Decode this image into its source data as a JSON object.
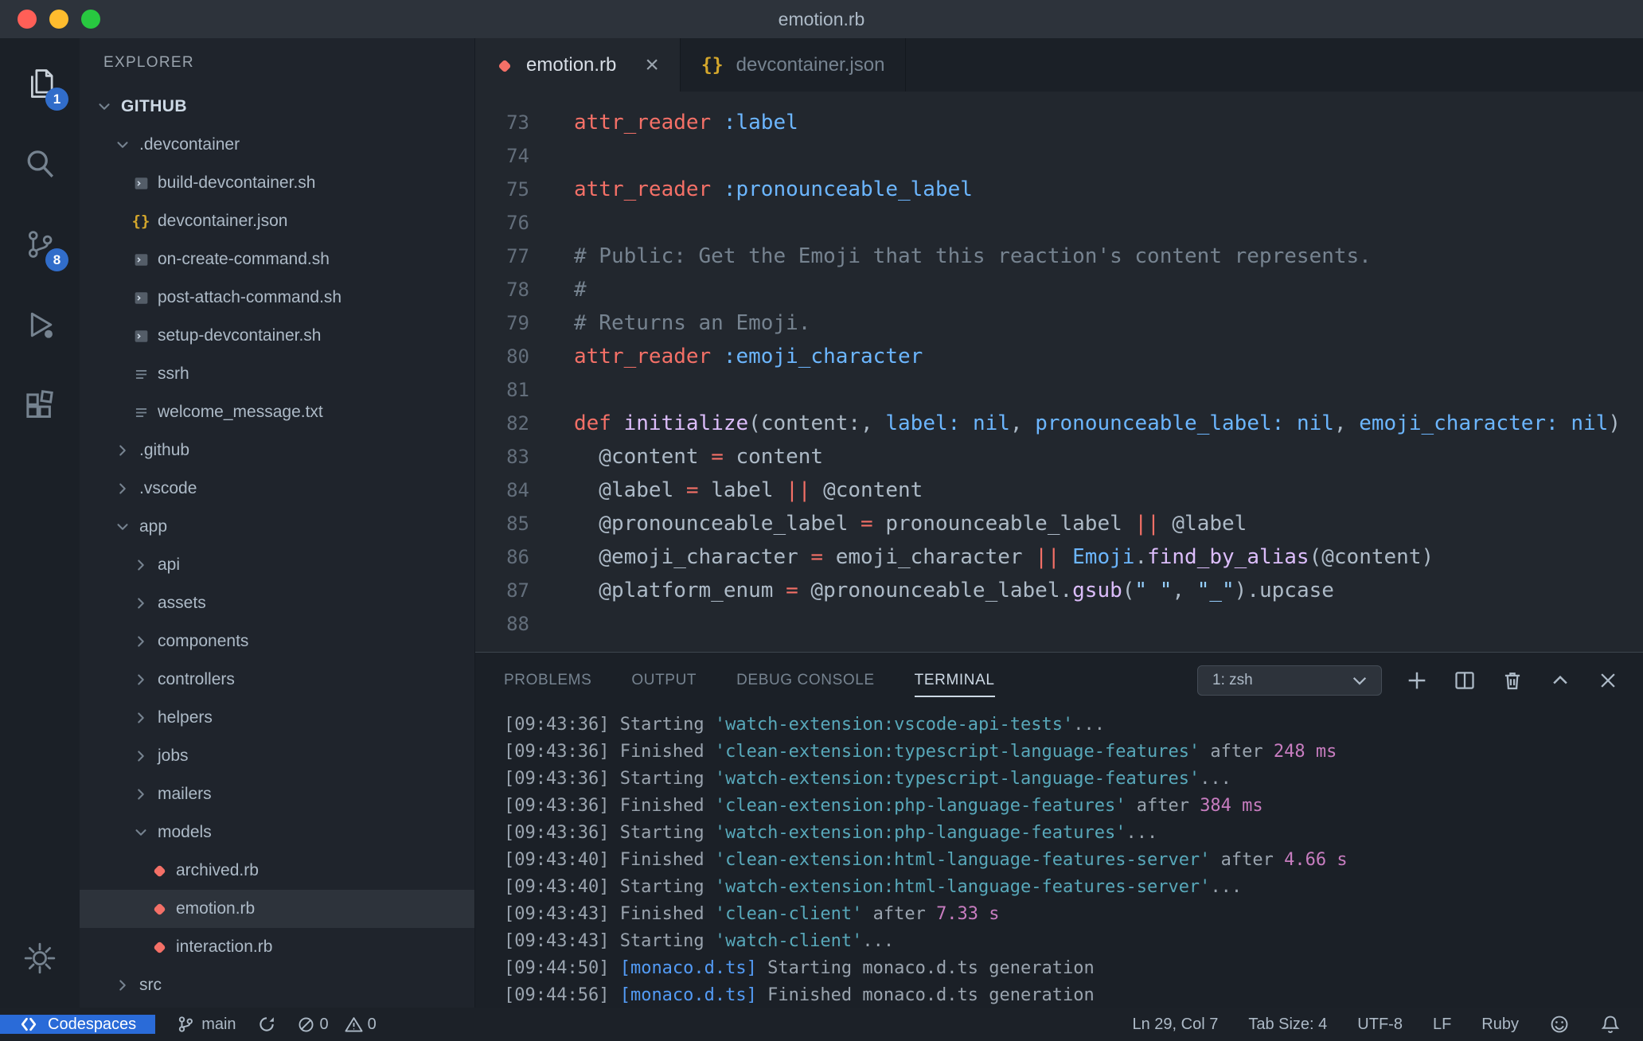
{
  "window": {
    "title": "emotion.rb"
  },
  "colors": {
    "accent_badge_blue": "#316dca",
    "remote_blue": "#2a6bd8",
    "ruby_coral": "#f47067",
    "json_yellow": "#d4a72c",
    "traffic_red": "#ff5f57",
    "traffic_yellow": "#febc2e",
    "traffic_green": "#28c840"
  },
  "activity_bar": {
    "items": [
      {
        "id": "explorer",
        "icon": "files-icon",
        "badge": "1",
        "active": true
      },
      {
        "id": "search",
        "icon": "search-icon"
      },
      {
        "id": "source-control",
        "icon": "git-branch-icon",
        "badge": "8"
      },
      {
        "id": "run-debug",
        "icon": "run-debug-icon"
      },
      {
        "id": "extensions",
        "icon": "extensions-icon"
      }
    ],
    "settings_icon": "gear-icon"
  },
  "sidebar": {
    "header": "EXPLORER",
    "tree": [
      {
        "label": "GITHUB",
        "kind": "root",
        "expanded": true,
        "level": 0
      },
      {
        "label": ".devcontainer",
        "kind": "folder",
        "expanded": true,
        "level": 1
      },
      {
        "label": "build-devcontainer.sh",
        "kind": "sh",
        "level": 2
      },
      {
        "label": "devcontainer.json",
        "kind": "json",
        "level": 2
      },
      {
        "label": "on-create-command.sh",
        "kind": "sh",
        "level": 2
      },
      {
        "label": "post-attach-command.sh",
        "kind": "sh",
        "level": 2
      },
      {
        "label": "setup-devcontainer.sh",
        "kind": "sh",
        "level": 2
      },
      {
        "label": "ssrh",
        "kind": "txt",
        "level": 2
      },
      {
        "label": "welcome_message.txt",
        "kind": "txt",
        "level": 2
      },
      {
        "label": ".github",
        "kind": "folder",
        "expanded": false,
        "level": 1
      },
      {
        "label": ".vscode",
        "kind": "folder",
        "expanded": false,
        "level": 1
      },
      {
        "label": "app",
        "kind": "folder",
        "expanded": true,
        "level": 1
      },
      {
        "label": "api",
        "kind": "folder",
        "expanded": false,
        "level": 2
      },
      {
        "label": "assets",
        "kind": "folder",
        "expanded": false,
        "level": 2
      },
      {
        "label": "components",
        "kind": "folder",
        "expanded": false,
        "level": 2
      },
      {
        "label": "controllers",
        "kind": "folder",
        "expanded": false,
        "level": 2
      },
      {
        "label": "helpers",
        "kind": "folder",
        "expanded": false,
        "level": 2
      },
      {
        "label": "jobs",
        "kind": "folder",
        "expanded": false,
        "level": 2
      },
      {
        "label": "mailers",
        "kind": "folder",
        "expanded": false,
        "level": 2
      },
      {
        "label": "models",
        "kind": "folder",
        "expanded": true,
        "level": 2
      },
      {
        "label": "archived.rb",
        "kind": "ruby",
        "level": 3
      },
      {
        "label": "emotion.rb",
        "kind": "ruby",
        "level": 3,
        "selected": true
      },
      {
        "label": "interaction.rb",
        "kind": "ruby",
        "level": 3
      },
      {
        "label": "src",
        "kind": "folder",
        "expanded": false,
        "level": 1
      }
    ]
  },
  "editor": {
    "tabs": [
      {
        "label": "emotion.rb",
        "icon": "ruby",
        "active": true,
        "close_glyph": "×"
      },
      {
        "label": "devcontainer.json",
        "icon": "json",
        "active": false
      }
    ],
    "lines": [
      {
        "n": "73",
        "toks": [
          [
            "r",
            "attr_reader"
          ],
          [
            "p",
            " "
          ],
          [
            "b",
            ":label"
          ]
        ]
      },
      {
        "n": "74",
        "toks": []
      },
      {
        "n": "75",
        "toks": [
          [
            "r",
            "attr_reader"
          ],
          [
            "p",
            " "
          ],
          [
            "b",
            ":pronounceable_label"
          ]
        ]
      },
      {
        "n": "76",
        "toks": []
      },
      {
        "n": "77",
        "toks": [
          [
            "c",
            "# Public: Get the Emoji that this reaction's content represents."
          ]
        ]
      },
      {
        "n": "78",
        "toks": [
          [
            "c",
            "#"
          ]
        ]
      },
      {
        "n": "79",
        "toks": [
          [
            "c",
            "# Returns an Emoji."
          ]
        ]
      },
      {
        "n": "80",
        "toks": [
          [
            "r",
            "attr_reader"
          ],
          [
            "p",
            " "
          ],
          [
            "b",
            ":emoji_character"
          ]
        ]
      },
      {
        "n": "81",
        "toks": []
      },
      {
        "n": "82",
        "toks": [
          [
            "r",
            "def"
          ],
          [
            "p",
            " "
          ],
          [
            "v",
            "initialize"
          ],
          [
            "p",
            "(content:, "
          ],
          [
            "b",
            "label:"
          ],
          [
            "p",
            " "
          ],
          [
            "b",
            "nil"
          ],
          [
            "p",
            ", "
          ],
          [
            "b",
            "pronounceable_label:"
          ],
          [
            "p",
            " "
          ],
          [
            "b",
            "nil"
          ],
          [
            "p",
            ", "
          ],
          [
            "b",
            "emoji_character:"
          ],
          [
            "p",
            " "
          ],
          [
            "b",
            "nil"
          ],
          [
            "p",
            ")"
          ]
        ]
      },
      {
        "n": "83",
        "toks": [
          [
            "p",
            "  @content "
          ],
          [
            "r",
            "="
          ],
          [
            "p",
            " content"
          ]
        ]
      },
      {
        "n": "84",
        "toks": [
          [
            "p",
            "  @label "
          ],
          [
            "r",
            "="
          ],
          [
            "p",
            " label "
          ],
          [
            "r",
            "||"
          ],
          [
            "p",
            " @content"
          ]
        ]
      },
      {
        "n": "85",
        "toks": [
          [
            "p",
            "  @pronounceable_label "
          ],
          [
            "r",
            "="
          ],
          [
            "p",
            " pronounceable_label "
          ],
          [
            "r",
            "||"
          ],
          [
            "p",
            " @label"
          ]
        ]
      },
      {
        "n": "86",
        "toks": [
          [
            "p",
            "  @emoji_character "
          ],
          [
            "r",
            "="
          ],
          [
            "p",
            " emoji_character "
          ],
          [
            "r",
            "||"
          ],
          [
            "p",
            " "
          ],
          [
            "b",
            "Emoji"
          ],
          [
            "p",
            "."
          ],
          [
            "v",
            "find_by_alias"
          ],
          [
            "p",
            "(@content)"
          ]
        ]
      },
      {
        "n": "87",
        "toks": [
          [
            "p",
            "  @platform_enum "
          ],
          [
            "r",
            "="
          ],
          [
            "p",
            " @pronounceable_label."
          ],
          [
            "v",
            "gsub"
          ],
          [
            "p",
            "("
          ],
          [
            "s",
            "\" \""
          ],
          [
            "p",
            ", "
          ],
          [
            "s",
            "\"_\""
          ],
          [
            "p",
            ").upcase"
          ]
        ]
      },
      {
        "n": "88",
        "toks": []
      }
    ]
  },
  "panel": {
    "tabs": [
      "PROBLEMS",
      "OUTPUT",
      "DEBUG CONSOLE",
      "TERMINAL"
    ],
    "active_tab": "TERMINAL",
    "shell_label": "1: zsh",
    "terminal_lines": [
      [
        [
          "g",
          "[09:43:36] Starting "
        ],
        [
          "cy",
          "'watch-extension:vscode-api-tests'"
        ],
        [
          "g",
          "..."
        ]
      ],
      [
        [
          "g",
          "[09:43:36] Finished "
        ],
        [
          "cy",
          "'clean-extension:typescript-language-features'"
        ],
        [
          "g",
          " after "
        ],
        [
          "m",
          "248 ms"
        ]
      ],
      [
        [
          "g",
          "[09:43:36] Starting "
        ],
        [
          "cy",
          "'watch-extension:typescript-language-features'"
        ],
        [
          "g",
          "..."
        ]
      ],
      [
        [
          "g",
          "[09:43:36] Finished "
        ],
        [
          "cy",
          "'clean-extension:php-language-features'"
        ],
        [
          "g",
          " after "
        ],
        [
          "m",
          "384 ms"
        ]
      ],
      [
        [
          "g",
          "[09:43:36] Starting "
        ],
        [
          "cy",
          "'watch-extension:php-language-features'"
        ],
        [
          "g",
          "..."
        ]
      ],
      [
        [
          "g",
          "[09:43:40] Finished "
        ],
        [
          "cy",
          "'clean-extension:html-language-features-server'"
        ],
        [
          "g",
          " after "
        ],
        [
          "m",
          "4.66 s"
        ]
      ],
      [
        [
          "g",
          "[09:43:40] Starting "
        ],
        [
          "cy",
          "'watch-extension:html-language-features-server'"
        ],
        [
          "g",
          "..."
        ]
      ],
      [
        [
          "g",
          "[09:43:43] Finished "
        ],
        [
          "cy",
          "'clean-client'"
        ],
        [
          "g",
          " after "
        ],
        [
          "m",
          "7.33 s"
        ]
      ],
      [
        [
          "g",
          "[09:43:43] Starting "
        ],
        [
          "cy",
          "'watch-client'"
        ],
        [
          "g",
          "..."
        ]
      ],
      [
        [
          "g",
          "[09:44:50] "
        ],
        [
          "bl",
          "[monaco.d.ts]"
        ],
        [
          "g",
          " Starting monaco.d.ts generation"
        ]
      ],
      [
        [
          "g",
          "[09:44:56] "
        ],
        [
          "bl",
          "[monaco.d.ts]"
        ],
        [
          "g",
          " Finished monaco.d.ts generation"
        ]
      ]
    ]
  },
  "status_bar": {
    "remote_label": "Codespaces",
    "branch": "main",
    "errors": "0",
    "warnings": "0",
    "line_col": "Ln 29, Col 7",
    "indent": "Tab Size: 4",
    "encoding": "UTF-8",
    "eol": "LF",
    "language": "Ruby"
  }
}
